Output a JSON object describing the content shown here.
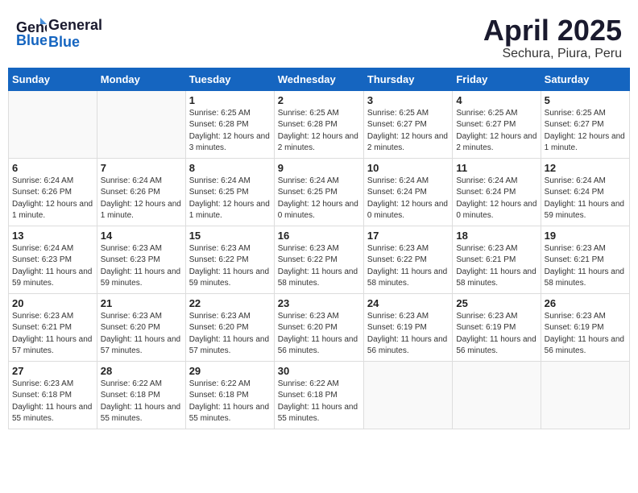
{
  "header": {
    "logo_general": "General",
    "logo_blue": "Blue",
    "title": "April 2025",
    "location": "Sechura, Piura, Peru"
  },
  "weekdays": [
    "Sunday",
    "Monday",
    "Tuesday",
    "Wednesday",
    "Thursday",
    "Friday",
    "Saturday"
  ],
  "weeks": [
    [
      {
        "day": "",
        "info": ""
      },
      {
        "day": "",
        "info": ""
      },
      {
        "day": "1",
        "info": "Sunrise: 6:25 AM\nSunset: 6:28 PM\nDaylight: 12 hours and 3 minutes."
      },
      {
        "day": "2",
        "info": "Sunrise: 6:25 AM\nSunset: 6:28 PM\nDaylight: 12 hours and 2 minutes."
      },
      {
        "day": "3",
        "info": "Sunrise: 6:25 AM\nSunset: 6:27 PM\nDaylight: 12 hours and 2 minutes."
      },
      {
        "day": "4",
        "info": "Sunrise: 6:25 AM\nSunset: 6:27 PM\nDaylight: 12 hours and 2 minutes."
      },
      {
        "day": "5",
        "info": "Sunrise: 6:25 AM\nSunset: 6:27 PM\nDaylight: 12 hours and 1 minute."
      }
    ],
    [
      {
        "day": "6",
        "info": "Sunrise: 6:24 AM\nSunset: 6:26 PM\nDaylight: 12 hours and 1 minute."
      },
      {
        "day": "7",
        "info": "Sunrise: 6:24 AM\nSunset: 6:26 PM\nDaylight: 12 hours and 1 minute."
      },
      {
        "day": "8",
        "info": "Sunrise: 6:24 AM\nSunset: 6:25 PM\nDaylight: 12 hours and 1 minute."
      },
      {
        "day": "9",
        "info": "Sunrise: 6:24 AM\nSunset: 6:25 PM\nDaylight: 12 hours and 0 minutes."
      },
      {
        "day": "10",
        "info": "Sunrise: 6:24 AM\nSunset: 6:24 PM\nDaylight: 12 hours and 0 minutes."
      },
      {
        "day": "11",
        "info": "Sunrise: 6:24 AM\nSunset: 6:24 PM\nDaylight: 12 hours and 0 minutes."
      },
      {
        "day": "12",
        "info": "Sunrise: 6:24 AM\nSunset: 6:24 PM\nDaylight: 11 hours and 59 minutes."
      }
    ],
    [
      {
        "day": "13",
        "info": "Sunrise: 6:24 AM\nSunset: 6:23 PM\nDaylight: 11 hours and 59 minutes."
      },
      {
        "day": "14",
        "info": "Sunrise: 6:23 AM\nSunset: 6:23 PM\nDaylight: 11 hours and 59 minutes."
      },
      {
        "day": "15",
        "info": "Sunrise: 6:23 AM\nSunset: 6:22 PM\nDaylight: 11 hours and 59 minutes."
      },
      {
        "day": "16",
        "info": "Sunrise: 6:23 AM\nSunset: 6:22 PM\nDaylight: 11 hours and 58 minutes."
      },
      {
        "day": "17",
        "info": "Sunrise: 6:23 AM\nSunset: 6:22 PM\nDaylight: 11 hours and 58 minutes."
      },
      {
        "day": "18",
        "info": "Sunrise: 6:23 AM\nSunset: 6:21 PM\nDaylight: 11 hours and 58 minutes."
      },
      {
        "day": "19",
        "info": "Sunrise: 6:23 AM\nSunset: 6:21 PM\nDaylight: 11 hours and 58 minutes."
      }
    ],
    [
      {
        "day": "20",
        "info": "Sunrise: 6:23 AM\nSunset: 6:21 PM\nDaylight: 11 hours and 57 minutes."
      },
      {
        "day": "21",
        "info": "Sunrise: 6:23 AM\nSunset: 6:20 PM\nDaylight: 11 hours and 57 minutes."
      },
      {
        "day": "22",
        "info": "Sunrise: 6:23 AM\nSunset: 6:20 PM\nDaylight: 11 hours and 57 minutes."
      },
      {
        "day": "23",
        "info": "Sunrise: 6:23 AM\nSunset: 6:20 PM\nDaylight: 11 hours and 56 minutes."
      },
      {
        "day": "24",
        "info": "Sunrise: 6:23 AM\nSunset: 6:19 PM\nDaylight: 11 hours and 56 minutes."
      },
      {
        "day": "25",
        "info": "Sunrise: 6:23 AM\nSunset: 6:19 PM\nDaylight: 11 hours and 56 minutes."
      },
      {
        "day": "26",
        "info": "Sunrise: 6:23 AM\nSunset: 6:19 PM\nDaylight: 11 hours and 56 minutes."
      }
    ],
    [
      {
        "day": "27",
        "info": "Sunrise: 6:23 AM\nSunset: 6:18 PM\nDaylight: 11 hours and 55 minutes."
      },
      {
        "day": "28",
        "info": "Sunrise: 6:22 AM\nSunset: 6:18 PM\nDaylight: 11 hours and 55 minutes."
      },
      {
        "day": "29",
        "info": "Sunrise: 6:22 AM\nSunset: 6:18 PM\nDaylight: 11 hours and 55 minutes."
      },
      {
        "day": "30",
        "info": "Sunrise: 6:22 AM\nSunset: 6:18 PM\nDaylight: 11 hours and 55 minutes."
      },
      {
        "day": "",
        "info": ""
      },
      {
        "day": "",
        "info": ""
      },
      {
        "day": "",
        "info": ""
      }
    ]
  ]
}
